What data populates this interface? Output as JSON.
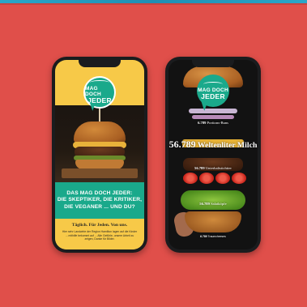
{
  "logo": {
    "line1": "MAG DOCH",
    "line2": "JEDER"
  },
  "left_phone": {
    "headline_lines": [
      "DAS MAG DOCH JEDER:",
      "DIE SKEPTIKER, DIE KRITIKER,",
      "DIE VEGANER ... UND DU?"
    ],
    "tagline": "Täglich. Für Jeden. Von uns.",
    "body_text": "Hier sehr Landwirte der Region Hamilton lagen auf die Kinder ... mithilfe bekommt auf ... Alle Gefühle, unsere Arbeit zu zeigen, Danke für Bilder."
  },
  "right_phone": {
    "stats": [
      {
        "num": "6.789",
        "label": "Portions-Buns"
      },
      {
        "num": "56.789",
        "label": "Weltenliter Milch"
      },
      {
        "num": "56.789",
        "label": "Unterhaltstichtier"
      },
      {
        "num": "56.789",
        "label": "Salatköpfe"
      },
      {
        "num": "6.789",
        "label": "Traumcheeses"
      }
    ]
  },
  "colors": {
    "background": "#e04f4a",
    "teal": "#1aa98b",
    "yellow": "#f7c948",
    "phone": "#1b1c1e"
  }
}
